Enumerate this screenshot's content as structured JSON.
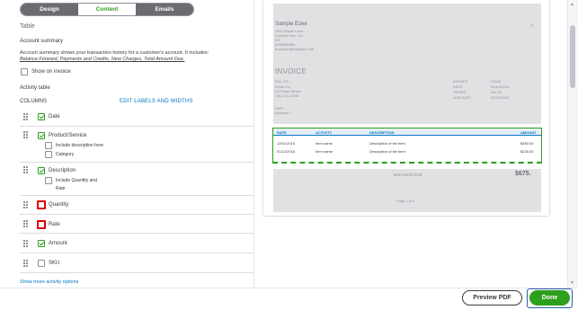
{
  "tabs": [
    {
      "label": "Design"
    },
    {
      "label": "Content"
    },
    {
      "label": "Emails"
    }
  ],
  "section_title": "Table",
  "account_summary": {
    "heading": "Account summary",
    "description_line1": "Account summary shows your transaction history for a customer's account. It includes:",
    "description_line2": "Balance Forward, Payments and Credits, New Charges, Total Amount Due.",
    "show_on_invoice_label": "Show on invoice"
  },
  "activity_table": {
    "heading": "Activity table",
    "columns_label": "COLUMNS",
    "edit_link": "EDIT LABELS AND WIDTHS",
    "items": [
      {
        "label": "Date",
        "checked": true
      },
      {
        "label": "Product/Service",
        "checked": true,
        "sub": [
          "Include description here",
          "Category"
        ]
      },
      {
        "label": "Description",
        "checked": true,
        "sub": [
          "Include Quantity and",
          "Rate"
        ]
      },
      {
        "label": "Quantity",
        "checked": false
      },
      {
        "label": "Rate",
        "checked": false
      },
      {
        "label": "Amount",
        "checked": true
      },
      {
        "label": "SKU",
        "checked": false
      }
    ],
    "more_link": "Show more activity options"
  },
  "preview": {
    "company": "Sample Ezee",
    "address": [
      "1612 Maple Lane",
      "Anytown Ave, CA",
      "US",
      "5555555555",
      "anystore@example.com"
    ],
    "invoice_title": "INVOICE",
    "bill_to": [
      "BILL TO",
      "Smith Co.",
      "123 Main Street",
      "City, CA 12345"
    ],
    "meta_labels": [
      "INVOICE",
      "DATE",
      "TERMS",
      "DUE DATE"
    ],
    "meta_values": [
      "12345",
      "01/12/2016",
      "Net 30",
      "02/12/2016"
    ],
    "ship_to": [
      "SHIP",
      "Address 1"
    ],
    "table_headers": [
      "DATE",
      "ACTIVITY",
      "DESCRIPTION",
      "AMOUNT"
    ],
    "rows": [
      {
        "date": "12/01/2016",
        "activity": "Item name",
        "description": "Description of the item",
        "amount": "$450.00"
      },
      {
        "date": "01/12/2016",
        "activity": "Item name",
        "description": "Description of the item",
        "amount": "$225.00"
      }
    ],
    "balance_label": "BALANCE DUE",
    "balance_value": "$675.",
    "page_label": "Page 1 of 1"
  },
  "footer": {
    "preview_label": "Preview PDF",
    "done_label": "Done"
  },
  "colors": {
    "accent": "#2ca01c",
    "link": "#0077c5",
    "highlight": "#e00000"
  }
}
